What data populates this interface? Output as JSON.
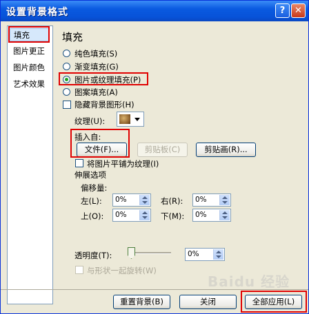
{
  "window": {
    "title": "设置背景格式"
  },
  "titlebar": {
    "help_glyph": "?",
    "close_glyph": "✕"
  },
  "sidebar": {
    "items": [
      {
        "label": "填充",
        "selected": true
      },
      {
        "label": "图片更正",
        "selected": false
      },
      {
        "label": "图片颜色",
        "selected": false
      },
      {
        "label": "艺术效果",
        "selected": false
      }
    ]
  },
  "fill": {
    "heading": "填充",
    "options": [
      {
        "label": "纯色填充(S)",
        "selected": false
      },
      {
        "label": "渐变填充(G)",
        "selected": false
      },
      {
        "label": "图片或纹理填充(P)",
        "selected": true
      },
      {
        "label": "图案填充(A)",
        "selected": false
      }
    ],
    "hide_bg_label": "隐藏背景图形(H)",
    "texture_label": "纹理(U):",
    "insert_from_label": "插入自:",
    "file_button": "文件(F)...",
    "clipboard_button": "剪贴板(C)",
    "clipart_button": "剪贴画(R)...",
    "tile_label": "将图片平铺为纹理(I)",
    "stretch_label": "伸展选项",
    "offset_label": "偏移量:",
    "offsets": {
      "left": {
        "label": "左(L):",
        "value": "0%"
      },
      "right": {
        "label": "右(R):",
        "value": "0%"
      },
      "top": {
        "label": "上(O):",
        "value": "0%"
      },
      "bottom": {
        "label": "下(M):",
        "value": "0%"
      }
    },
    "transparency_label": "透明度(T):",
    "transparency_value": "0%",
    "transparency_level": 0,
    "rotate_label": "与形状一起旋转(W)"
  },
  "footer": {
    "reset_button": "重置背景(B)",
    "close_button": "关闭",
    "apply_all_button": "全部应用(L)"
  },
  "watermark": "Baidu 经验",
  "colors": {
    "titlebar": "#0a5ae0",
    "dialog_bg": "#ece9d8",
    "highlight_box": "#e00000",
    "selected_radio": "#21a121"
  }
}
